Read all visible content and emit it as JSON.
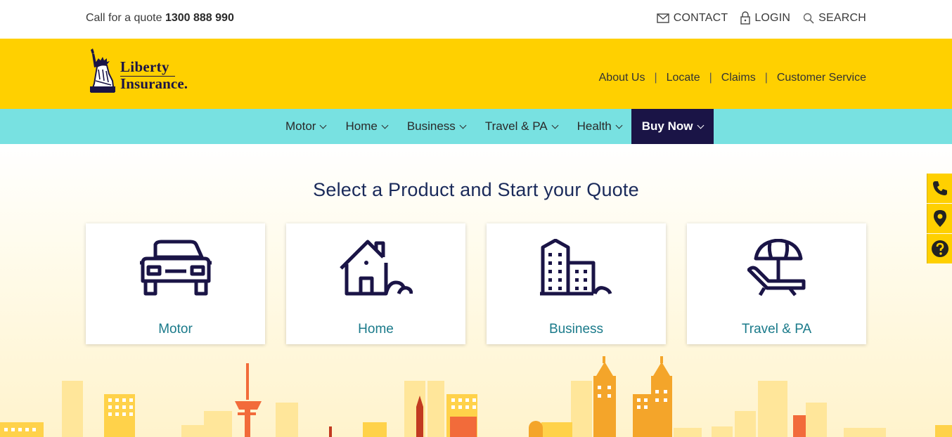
{
  "topbar": {
    "quote_prefix": "Call for a quote",
    "phone": "1300 888 990",
    "links": [
      {
        "label": "CONTACT",
        "icon": "envelope-icon"
      },
      {
        "label": "LOGIN",
        "icon": "padlock-icon"
      },
      {
        "label": "SEARCH",
        "icon": "search-icon"
      }
    ]
  },
  "brand": {
    "line1": "Liberty",
    "line2": "Insurance.",
    "colors": {
      "yellow": "#ffd000",
      "navy": "#1a1446",
      "teal": "#78e1e1"
    }
  },
  "secondary_nav": [
    "About Us",
    "Locate",
    "Claims",
    "Customer Service"
  ],
  "main_nav": [
    {
      "label": "Motor"
    },
    {
      "label": "Home"
    },
    {
      "label": "Business"
    },
    {
      "label": "Travel & PA"
    },
    {
      "label": "Health"
    },
    {
      "label": "Buy Now"
    }
  ],
  "section": {
    "heading": "Select a Product and Start your Quote",
    "products": [
      {
        "label": "Motor",
        "icon": "car-icon"
      },
      {
        "label": "Home",
        "icon": "house-icon"
      },
      {
        "label": "Business",
        "icon": "building-icon"
      },
      {
        "label": "Travel & PA",
        "icon": "beach-chair-umbrella-icon"
      }
    ]
  },
  "floating_actions": [
    {
      "icon": "phone-icon"
    },
    {
      "icon": "location-pin-icon"
    },
    {
      "icon": "help-icon"
    }
  ]
}
